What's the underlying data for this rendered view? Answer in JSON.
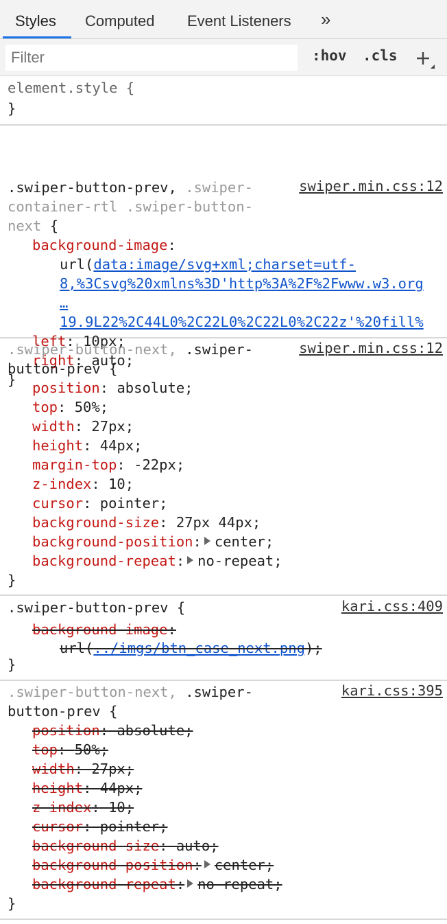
{
  "tabs": {
    "styles": "Styles",
    "computed": "Computed",
    "event_listeners": "Event Listeners",
    "more": "»"
  },
  "toolbar": {
    "filter_placeholder": "Filter",
    "hov": ":hov",
    "cls": ".cls",
    "new_rule": "+"
  },
  "rules": {
    "element_style": {
      "selector": "element.style {",
      "close": "}"
    },
    "r1": {
      "sel_a": ".swiper-button-prev, ",
      "sel_b": ".swiper-",
      "sel_c": "container-rtl .swiper-button-",
      "sel_d": "next",
      "sel_e": " {",
      "source": "swiper.min.css:12",
      "bg_name": "background-image",
      "bg_url_open": "url(",
      "bg_url_l1": "data:image/svg+xml;charset=utf-",
      "bg_url_l2": "8,%3Csvg%20xmlns%3D'http%3A%2F%2Fwww.w3.org",
      "bg_url_l3": "…",
      "bg_url_l4": "19.9L22%2C44L0%2C22L0%2C22L0%2C22z'%20fill%",
      "left_name": "left",
      "left_val": "10px",
      "right_name": "right",
      "right_val": "auto",
      "close": "}"
    },
    "r2": {
      "sel_a": ".swiper-button-next, ",
      "sel_b": ".swiper-",
      "sel_c": "button-prev",
      "sel_d": " {",
      "source": "swiper.min.css:12",
      "decls": [
        {
          "name": "position",
          "value": "absolute;"
        },
        {
          "name": "top",
          "value": "50%;"
        },
        {
          "name": "width",
          "value": "27px;"
        },
        {
          "name": "height",
          "value": "44px;"
        },
        {
          "name": "margin-top",
          "value": "-22px;"
        },
        {
          "name": "z-index",
          "value": "10;"
        },
        {
          "name": "cursor",
          "value": "pointer;"
        },
        {
          "name": "background-size",
          "value": "27px 44px;"
        },
        {
          "name": "background-position",
          "value": "center;"
        },
        {
          "name": "background-repeat",
          "value": "no-repeat;"
        }
      ],
      "close": "}"
    },
    "r3": {
      "selector": ".swiper-button-prev {",
      "source": "kari.css:409",
      "bg_name": "background-image",
      "url_open": "url(",
      "url_link": "../imgs/btn_case_next.png",
      "url_close": ");",
      "close": "}"
    },
    "r4": {
      "sel_a": ".swiper-button-next, ",
      "sel_b": ".swiper-",
      "sel_c": "button-prev",
      "sel_d": " {",
      "source": "kari.css:395",
      "decls": [
        {
          "name": "position",
          "value": "absolute;"
        },
        {
          "name": "top",
          "value": "50%;"
        },
        {
          "name": "width",
          "value": "27px;"
        },
        {
          "name": "height",
          "value": "44px;"
        },
        {
          "name": "z-index",
          "value": "10;"
        },
        {
          "name": "cursor",
          "value": "pointer;"
        },
        {
          "name": "background-size",
          "value": "auto;"
        },
        {
          "name": "background-position",
          "value": "center;"
        },
        {
          "name": "background-repeat",
          "value": "no-repeat;"
        }
      ],
      "close": "}"
    }
  },
  "colors": {
    "property_name": "#c41a16",
    "link": "#1155cc",
    "active_tab": "#1a73e8"
  }
}
